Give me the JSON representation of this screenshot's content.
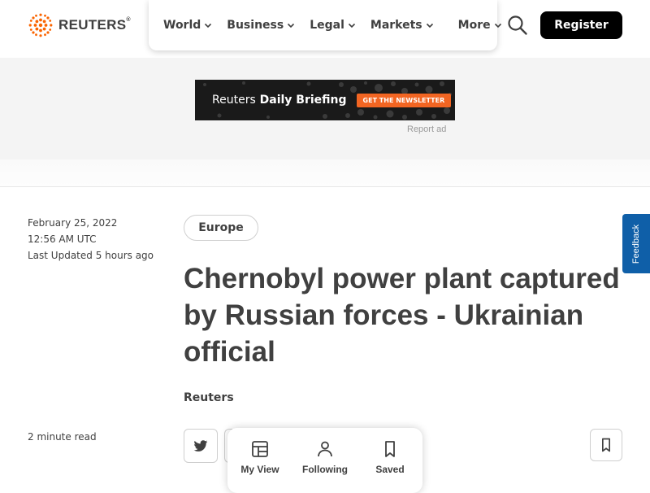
{
  "header": {
    "logo_text": "REUTERS",
    "logo_mark": "®",
    "nav": [
      {
        "label": "World"
      },
      {
        "label": "Business"
      },
      {
        "label": "Legal"
      },
      {
        "label": "Markets"
      },
      {
        "label": "More"
      }
    ],
    "register_label": "Register",
    "accent_color": "#fa6400"
  },
  "ad": {
    "brand_regular": "Reuters",
    "brand_bold": "Daily Briefing",
    "cta": "GET THE NEWSLETTER",
    "report_label": "Report ad"
  },
  "article": {
    "date": "February 25, 2022",
    "time": "12:56 AM UTC",
    "updated": "Last Updated 5 hours ago",
    "read_time": "2 minute read",
    "topic": "Europe",
    "headline": "Chernobyl power plant captured by Russian forces - Ukrainian official",
    "byline": "Reuters"
  },
  "feedback_label": "Feedback",
  "bottom_nav": [
    {
      "label": "My View",
      "icon": "layout-icon"
    },
    {
      "label": "Following",
      "icon": "person-icon"
    },
    {
      "label": "Saved",
      "icon": "bookmark-icon"
    }
  ]
}
